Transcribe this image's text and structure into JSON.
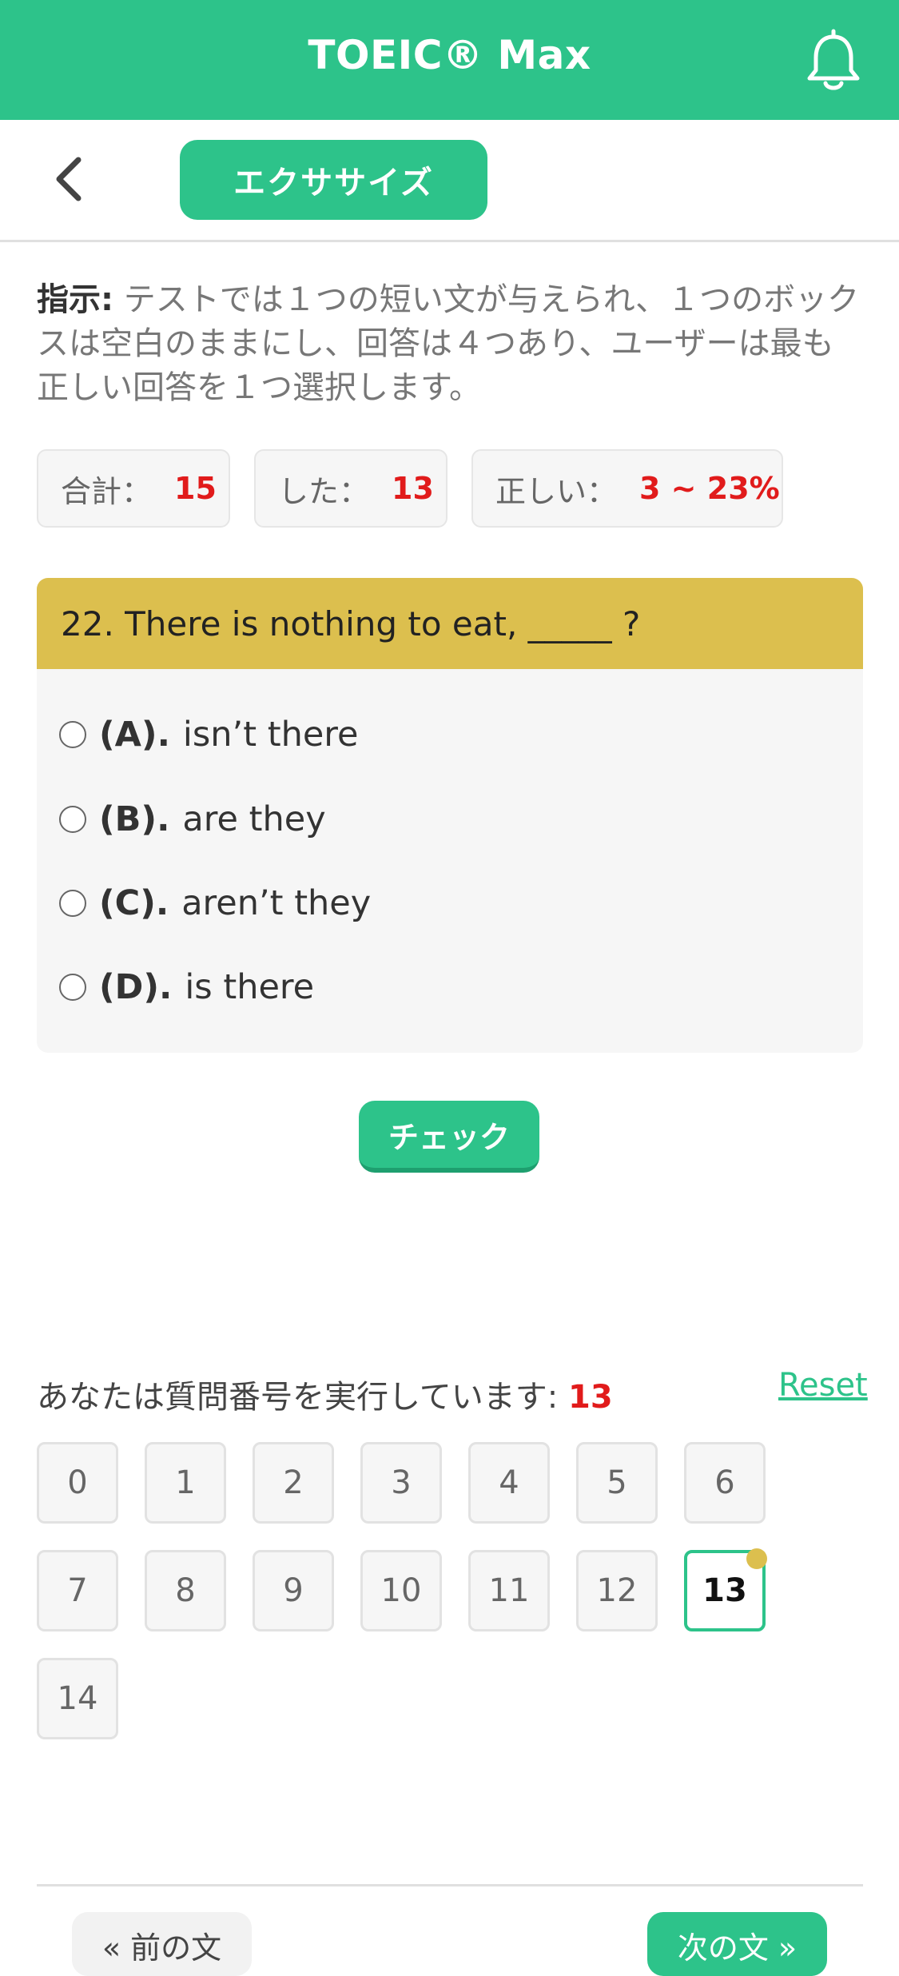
{
  "header": {
    "title": "TOEIC® Max",
    "bell_icon": "bell-icon",
    "background": "#2dc38a"
  },
  "nav": {
    "back_icon": "chevron-left-icon",
    "exercise_label": "エクササイズ"
  },
  "instructions": {
    "label": "指示:",
    "text": " テストでは１つの短い文が与えられ、１つのボックスは空白のままにし、回答は４つあり、ユーザーは最も正しい回答を１つ選択します。"
  },
  "stats": {
    "total_label": "合計：",
    "total_value": "15",
    "done_label": "した：",
    "done_value": "13",
    "correct_label": "正しい：",
    "correct_value": "3 ~ 23%"
  },
  "question": {
    "text": "22. There is nothing to eat, _____ ?",
    "options": [
      {
        "letter": "(A).",
        "text": "isn’t there"
      },
      {
        "letter": "(B).",
        "text": "are they"
      },
      {
        "letter": "(C).",
        "text": "aren’t they"
      },
      {
        "letter": "(D).",
        "text": "is there"
      }
    ]
  },
  "check_label": "チェック",
  "progress": {
    "running_label": "あなたは質問番号を実行しています:",
    "running_value": "13",
    "reset_label": "Reset",
    "current": "13",
    "numbers": [
      "0",
      "1",
      "2",
      "3",
      "4",
      "5",
      "6",
      "7",
      "8",
      "9",
      "10",
      "11",
      "12",
      "13",
      "14"
    ]
  },
  "footer": {
    "prev_label": "« 前の文",
    "next_label": "次の文 »"
  },
  "colors": {
    "accent": "#2dc38a",
    "question_header": "#dcbf4e",
    "highlight_red": "#e11b1b"
  }
}
